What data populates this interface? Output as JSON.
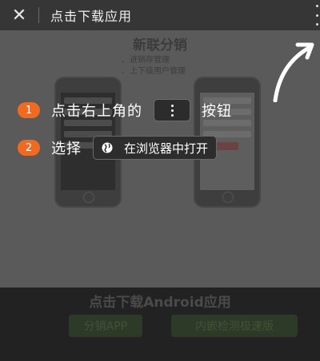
{
  "topbar": {
    "title": "点击下载应用"
  },
  "page": {
    "title": "新联分销",
    "features": [
      "、进销存管理",
      "、上下级用户管理"
    ]
  },
  "steps": [
    {
      "num": "1",
      "before": "点击右上角的",
      "after": "按钮"
    },
    {
      "num": "2",
      "before": "选择",
      "browser_label": "在浏览器中打开"
    }
  ],
  "bottom": {
    "title": "点击下载Android应用",
    "btn_left": "分销APP",
    "btn_right": "内嵌检测极速版"
  },
  "colors": {
    "badge": "#f06a21",
    "topbar": "#363636"
  }
}
